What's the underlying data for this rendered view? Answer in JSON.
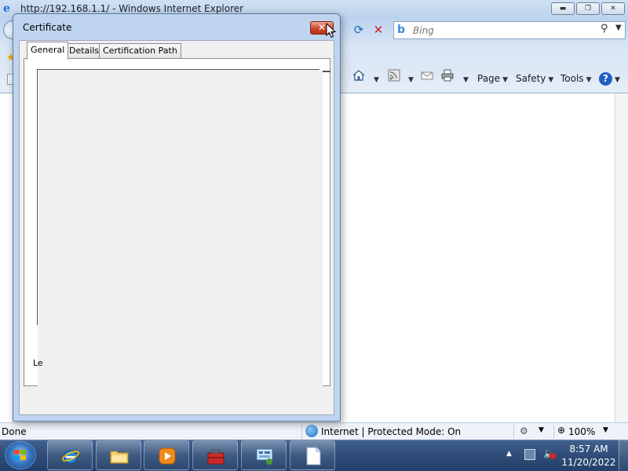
{
  "ie": {
    "title": "http://192.168.1.1/ - Windows Internet Explorer",
    "min_glyph": "▬",
    "max_glyph": "❐",
    "close_glyph": "✕",
    "refresh_glyph": "⟳",
    "stop_glyph": "✕",
    "search_placeholder": "Bing",
    "bing_glyph": "b",
    "search_glyph": "⚲",
    "dropdown_glyph": "▼"
  },
  "commandbar": {
    "page_label": "Page",
    "safety_label": "Safety",
    "tools_label": "Tools",
    "help_glyph": "?"
  },
  "statusbar": {
    "status_text": "Done",
    "zone_text": "Internet | Protected Mode: On",
    "zoom_text": "100%"
  },
  "certificate_dialog": {
    "title": "Certificate",
    "tabs": [
      {
        "label": "General"
      },
      {
        "label": "Details"
      },
      {
        "label": "Certification Path"
      }
    ],
    "learn_more_visible": "Le"
  },
  "taskbar": {
    "clock_time": "8:57 AM",
    "clock_date": "11/20/2022",
    "tray_arrow": "▲"
  },
  "colors": {
    "titlebar": "#bcd3ee",
    "dialog_frame": "#bfd5ef",
    "close_red": "#d0472d",
    "taskbar": "#2f4d77"
  },
  "icons": [
    "ie-logo-icon",
    "back-button-icon",
    "refresh-icon",
    "stop-icon",
    "bing-icon",
    "search-icon",
    "favorites-star-icon",
    "home-icon",
    "feeds-icon",
    "mail-icon",
    "print-icon",
    "help-icon",
    "globe-icon",
    "popup-blocker-icon",
    "zoom-icon",
    "windows-logo-icon",
    "folder-icon",
    "media-player-icon",
    "toolbox-icon",
    "network-icon",
    "document-icon",
    "volume-icon"
  ]
}
